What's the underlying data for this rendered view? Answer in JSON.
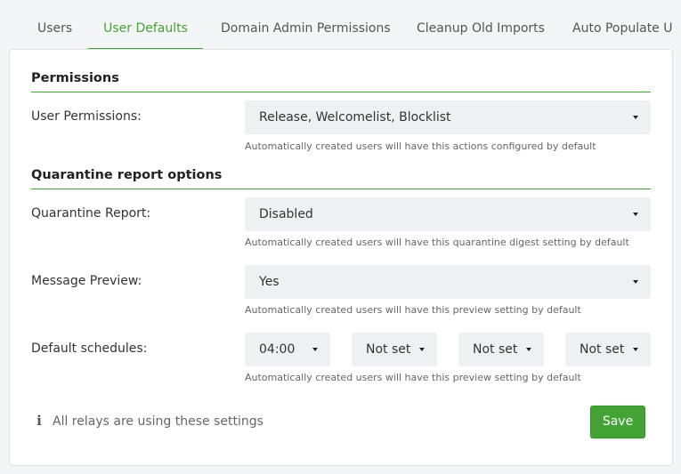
{
  "tabs": [
    {
      "label": "Users"
    },
    {
      "label": "User Defaults"
    },
    {
      "label": "Domain Admin Permissions"
    },
    {
      "label": "Cleanup Old Imports"
    },
    {
      "label": "Auto Populate U"
    }
  ],
  "permissions": {
    "title": "Permissions",
    "user_permissions": {
      "label": "User Permissions:",
      "value": "Release, Welcomelist, Blocklist",
      "help": "Automatically created users will have this actions configured by default"
    }
  },
  "quarantine": {
    "title": "Quarantine report options",
    "report": {
      "label": "Quarantine Report:",
      "value": "Disabled",
      "help": "Automatically created users will have this quarantine digest setting by default"
    },
    "preview": {
      "label": "Message Preview:",
      "value": "Yes",
      "help": "Automatically created users will have this preview setting by default"
    },
    "schedules": {
      "label": "Default schedules:",
      "values": [
        "04:00",
        "Not set",
        "Not set",
        "Not set"
      ],
      "help": "Automatically created users will have this preview setting by default"
    }
  },
  "footer": {
    "info_icon": "info-icon",
    "info_text": "All relays are using these settings",
    "save_label": "Save"
  },
  "colors": {
    "accent": "#43a435",
    "select_bg": "#eef0f4"
  }
}
